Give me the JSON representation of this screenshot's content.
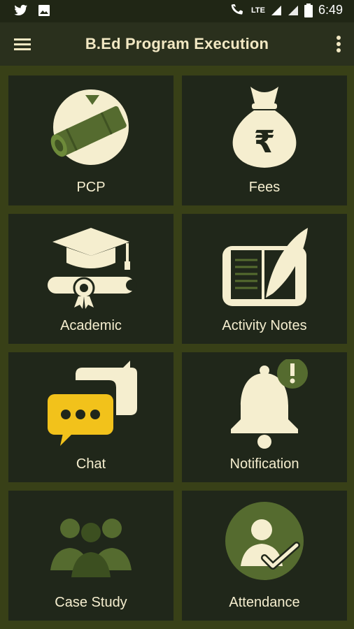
{
  "status": {
    "time": "6:49",
    "network": "LTE"
  },
  "app": {
    "title": "B.Ed Program Execution"
  },
  "tiles": [
    {
      "id": "pcp",
      "label": "PCP",
      "icon": "diploma-scroll-icon"
    },
    {
      "id": "fees",
      "label": "Fees",
      "icon": "money-bag-rupee-icon"
    },
    {
      "id": "academic",
      "label": "Academic",
      "icon": "graduation-cap-icon"
    },
    {
      "id": "activity",
      "label": "Activity Notes",
      "icon": "book-feather-icon"
    },
    {
      "id": "chat",
      "label": "Chat",
      "icon": "chat-bubbles-icon"
    },
    {
      "id": "notification",
      "label": "Notification",
      "icon": "bell-alert-icon"
    },
    {
      "id": "case",
      "label": "Case Study",
      "icon": "group-people-icon"
    },
    {
      "id": "attendance",
      "label": "Attendance",
      "icon": "attendance-check-icon"
    }
  ],
  "colors": {
    "accent": "#f5eecf",
    "bg": "#384017",
    "tile": "#20271a",
    "green": "#556b2f",
    "yellow": "#f2c21b"
  }
}
